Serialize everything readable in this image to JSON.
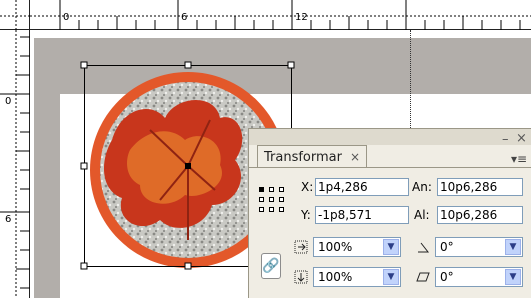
{
  "ruler": {
    "top_labels": [
      "0",
      "6",
      "12"
    ],
    "left_labels": [
      "0",
      "6"
    ]
  },
  "panel": {
    "tab_label": "Transformar",
    "tab_close": "×",
    "window_min": "–",
    "window_close": "×",
    "menu_glyph": "▾≡",
    "x_label": "X:",
    "x_value": "1p4,286",
    "y_label": "Y:",
    "y_value": "-1p8,571",
    "width_label": "An:",
    "width_value": "10p6,286",
    "height_label": "Al:",
    "height_value": "10p6,286",
    "scale_x": "100%",
    "scale_y": "100%",
    "rotation": "0°",
    "shear": "0°"
  },
  "icons": {
    "chain": "chain-link-icon",
    "scale_x": "scale-x-icon",
    "scale_y": "scale-y-icon",
    "rotate": "rotate-angle-icon",
    "shear": "shear-icon"
  },
  "colors": {
    "pasteboard": "#b2aeaa",
    "ring": "#e3582a",
    "panel_bg": "#f0ede4",
    "field_border": "#7f9db9"
  }
}
